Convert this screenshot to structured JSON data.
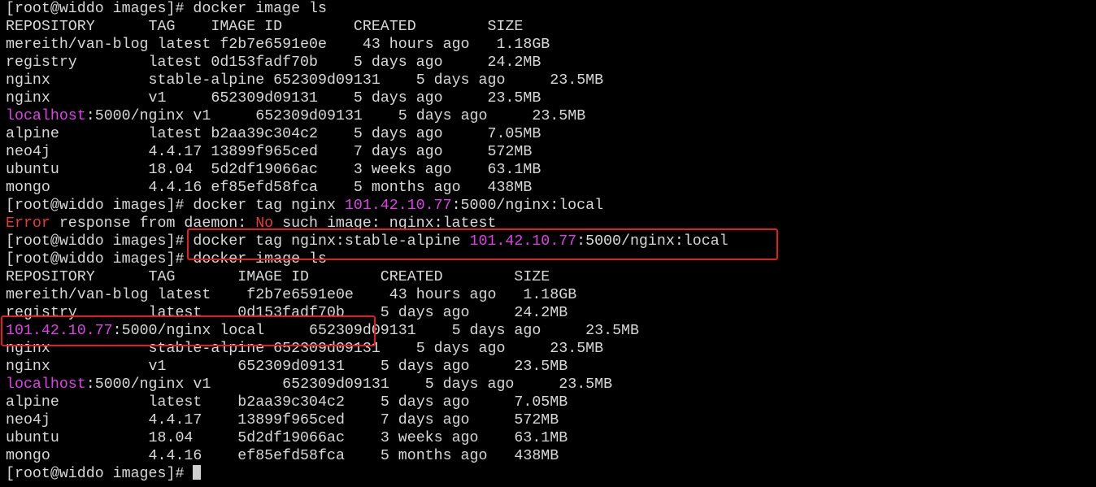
{
  "prompt": "[root@widdo images]#",
  "session": [
    {
      "kind": "cmd",
      "parts": [
        {
          "t": " docker image ls"
        }
      ]
    },
    {
      "kind": "table",
      "cols": [
        16,
        23,
        39,
        54,
        69
      ]
    },
    {
      "kind": "cmd",
      "parts": [
        {
          "t": " docker tag nginx "
        },
        {
          "t": "101.42.10.77",
          "c": "magenta"
        },
        {
          "t": ":5000/nginx:local"
        }
      ]
    },
    {
      "kind": "error",
      "parts": [
        {
          "t": "Error",
          "c": "red"
        },
        {
          "t": " response from daemon: "
        },
        {
          "t": "No",
          "c": "red"
        },
        {
          "t": " such image: nginx:latest"
        }
      ]
    },
    {
      "kind": "cmd",
      "parts": [
        {
          "t": " docker tag nginx:stable-alpine "
        },
        {
          "t": "101.42.10.77",
          "c": "magenta"
        },
        {
          "t": ":5000/nginx:local"
        }
      ]
    },
    {
      "kind": "cmd",
      "parts": [
        {
          "t": " docker image ls"
        }
      ]
    },
    {
      "kind": "table",
      "cols": [
        16,
        26,
        42,
        57,
        72
      ]
    },
    {
      "kind": "prompt_cursor"
    }
  ],
  "headers": [
    "REPOSITORY",
    "TAG",
    "IMAGE ID",
    "CREATED",
    "SIZE"
  ],
  "table1": [
    {
      "repo": [
        {
          "t": "mereith/van-blog"
        }
      ],
      "tag": "latest",
      "id": "f2b7e6591e0e",
      "created": "43 hours ago",
      "size": "1.18GB"
    },
    {
      "repo": [
        {
          "t": "registry"
        }
      ],
      "tag": "latest",
      "id": "0d153fadf70b",
      "created": "5 days ago",
      "size": "24.2MB"
    },
    {
      "repo": [
        {
          "t": "nginx"
        }
      ],
      "tag": "stable-alpine",
      "id": "652309d09131",
      "created": "5 days ago",
      "size": "23.5MB"
    },
    {
      "repo": [
        {
          "t": "nginx"
        }
      ],
      "tag": "v1",
      "id": "652309d09131",
      "created": "5 days ago",
      "size": "23.5MB"
    },
    {
      "repo": [
        {
          "t": "localhost",
          "c": "magenta"
        },
        {
          "t": ":5000/nginx"
        }
      ],
      "tag": "v1",
      "id": "652309d09131",
      "created": "5 days ago",
      "size": "23.5MB"
    },
    {
      "repo": [
        {
          "t": "alpine"
        }
      ],
      "tag": "latest",
      "id": "b2aa39c304c2",
      "created": "5 days ago",
      "size": "7.05MB"
    },
    {
      "repo": [
        {
          "t": "neo4j"
        }
      ],
      "tag": "4.4.17",
      "id": "13899f965ced",
      "created": "7 days ago",
      "size": "572MB"
    },
    {
      "repo": [
        {
          "t": "ubuntu"
        }
      ],
      "tag": "18.04",
      "id": "5d2df19066ac",
      "created": "3 weeks ago",
      "size": "63.1MB"
    },
    {
      "repo": [
        {
          "t": "mongo"
        }
      ],
      "tag": "4.4.16",
      "id": "ef85efd58fca",
      "created": "5 months ago",
      "size": "438MB"
    }
  ],
  "table2": [
    {
      "repo": [
        {
          "t": "mereith/van-blog"
        }
      ],
      "tag": "latest",
      "id": "f2b7e6591e0e",
      "created": "43 hours ago",
      "size": "1.18GB"
    },
    {
      "repo": [
        {
          "t": "registry"
        }
      ],
      "tag": "latest",
      "id": "0d153fadf70b",
      "created": "5 days ago",
      "size": "24.2MB"
    },
    {
      "repo": [
        {
          "t": "101.42.10.77",
          "c": "magenta"
        },
        {
          "t": ":5000/nginx"
        }
      ],
      "tag": "local",
      "id": "652309d09131",
      "created": "5 days ago",
      "size": "23.5MB"
    },
    {
      "repo": [
        {
          "t": "nginx"
        }
      ],
      "tag": "stable-alpine",
      "id": "652309d09131",
      "created": "5 days ago",
      "size": "23.5MB"
    },
    {
      "repo": [
        {
          "t": "nginx"
        }
      ],
      "tag": "v1",
      "id": "652309d09131",
      "created": "5 days ago",
      "size": "23.5MB"
    },
    {
      "repo": [
        {
          "t": "localhost",
          "c": "magenta"
        },
        {
          "t": ":5000/nginx"
        }
      ],
      "tag": "v1",
      "id": "652309d09131",
      "created": "5 days ago",
      "size": "23.5MB"
    },
    {
      "repo": [
        {
          "t": "alpine"
        }
      ],
      "tag": "latest",
      "id": "b2aa39c304c2",
      "created": "5 days ago",
      "size": "7.05MB"
    },
    {
      "repo": [
        {
          "t": "neo4j"
        }
      ],
      "tag": "4.4.17",
      "id": "13899f965ced",
      "created": "7 days ago",
      "size": "572MB"
    },
    {
      "repo": [
        {
          "t": "ubuntu"
        }
      ],
      "tag": "18.04",
      "id": "5d2df19066ac",
      "created": "3 weeks ago",
      "size": "63.1MB"
    },
    {
      "repo": [
        {
          "t": "mongo"
        }
      ],
      "tag": "4.4.16",
      "id": "ef85efd58fca",
      "created": "5 months ago",
      "size": "438MB"
    }
  ],
  "colors": {
    "background": "#000000",
    "foreground": "#d8d8d8",
    "magenta": "#e040e8",
    "error_red": "#e83a3a",
    "annotation_red": "#e02020"
  }
}
